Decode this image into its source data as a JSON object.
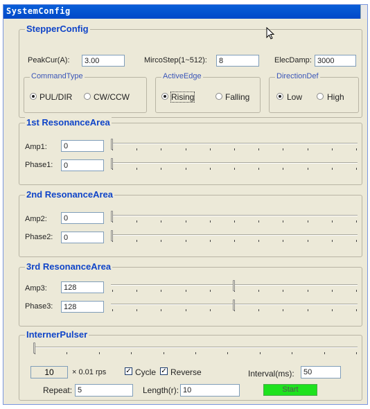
{
  "window": {
    "title": "SystemConfig"
  },
  "stepper": {
    "title": "StepperConfig",
    "peak_label": "PeakCur(A):",
    "peak_value": "3.00",
    "micro_label": "MircoStep(1~512):",
    "micro_value": "8",
    "elec_label": "ElecDamp:",
    "elec_value": "3000",
    "command": {
      "title": "CommandType",
      "opt1": "PUL/DIR",
      "opt2": "CW/CCW",
      "selected": "PUL/DIR"
    },
    "edge": {
      "title": "ActiveEdge",
      "opt1": "Rising",
      "opt2": "Falling",
      "selected": "Rising"
    },
    "direction": {
      "title": "DirectionDef",
      "opt1": "Low",
      "opt2": "High",
      "selected": "Low"
    }
  },
  "res1": {
    "title": "1st ResonanceArea",
    "amp_label": "Amp1:",
    "amp_value": "0",
    "phase_label": "Phase1:",
    "phase_value": "0",
    "amp_level": 0,
    "phase_level": 0
  },
  "res2": {
    "title": "2nd ResonanceArea",
    "amp_label": "Amp2:",
    "amp_value": "0",
    "phase_label": "Phase2:",
    "phase_value": "0",
    "amp_level": 0,
    "phase_level": 0
  },
  "res3": {
    "title": "3rd ResonanceArea",
    "amp_label": "Amp3:",
    "amp_value": "128",
    "phase_label": "Phase3:",
    "phase_value": "128",
    "amp_level": 0.5,
    "phase_level": 0.5
  },
  "pulser": {
    "title": "InternerPulser",
    "slider_level": 0,
    "rps_value": "10",
    "rps_unit": "× 0.01 rps",
    "cycle_label": "Cycle",
    "cycle_checked": true,
    "reverse_label": "Reverse",
    "reverse_checked": true,
    "interval_label": "Interval(ms):",
    "interval_value": "50",
    "repeat_label": "Repeat:",
    "repeat_value": "5",
    "length_label": "Length(r):",
    "length_value": "10",
    "start_label": "Start",
    "start_color": "#1ee21e"
  }
}
